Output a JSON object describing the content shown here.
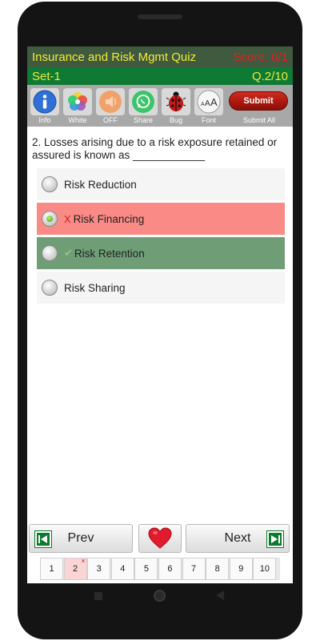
{
  "header": {
    "title": "Insurance and Risk Mgmt Quiz",
    "score": "Score: 0/1",
    "set": "Set-1",
    "question_number": "Q.2/10"
  },
  "toolbar": {
    "tools": [
      {
        "label": "Info",
        "icon": "info-icon",
        "color": "#2f6fd6"
      },
      {
        "label": "White",
        "icon": "color-wheel-icon"
      },
      {
        "label": "OFF",
        "icon": "speaker-icon",
        "color": "#f0a26a"
      },
      {
        "label": "Share",
        "icon": "whatsapp-icon",
        "color": "#3cc46a"
      },
      {
        "label": "Bug",
        "icon": "ladybug-icon",
        "color": "#c81818"
      },
      {
        "label": "Font",
        "icon": "font-size-icon"
      }
    ],
    "submit_label": "Submit",
    "submit_caption": "Submit All"
  },
  "question": {
    "text": "2. Losses arising due to a risk exposure retained or assured is known as ____________",
    "options": [
      {
        "label": "Risk Reduction",
        "state": "normal"
      },
      {
        "label": "Risk Financing",
        "state": "wrong",
        "mark": "X"
      },
      {
        "label": "Risk Retention",
        "state": "right",
        "mark": "✔"
      },
      {
        "label": "Risk Sharing",
        "state": "normal"
      }
    ]
  },
  "nav": {
    "prev": "Prev",
    "next": "Next",
    "pages": [
      "1",
      "2",
      "3",
      "4",
      "5",
      "6",
      "7",
      "8",
      "9",
      "10"
    ],
    "current_page": "2",
    "page_mark": "×"
  },
  "colors": {
    "title_bar": "#3f5a3f",
    "sub_bar": "#0e7a33",
    "title_text": "#f2e93a",
    "score_text": "#e02020",
    "wrong_bg": "#f98a86",
    "right_bg": "#6f9e76"
  }
}
